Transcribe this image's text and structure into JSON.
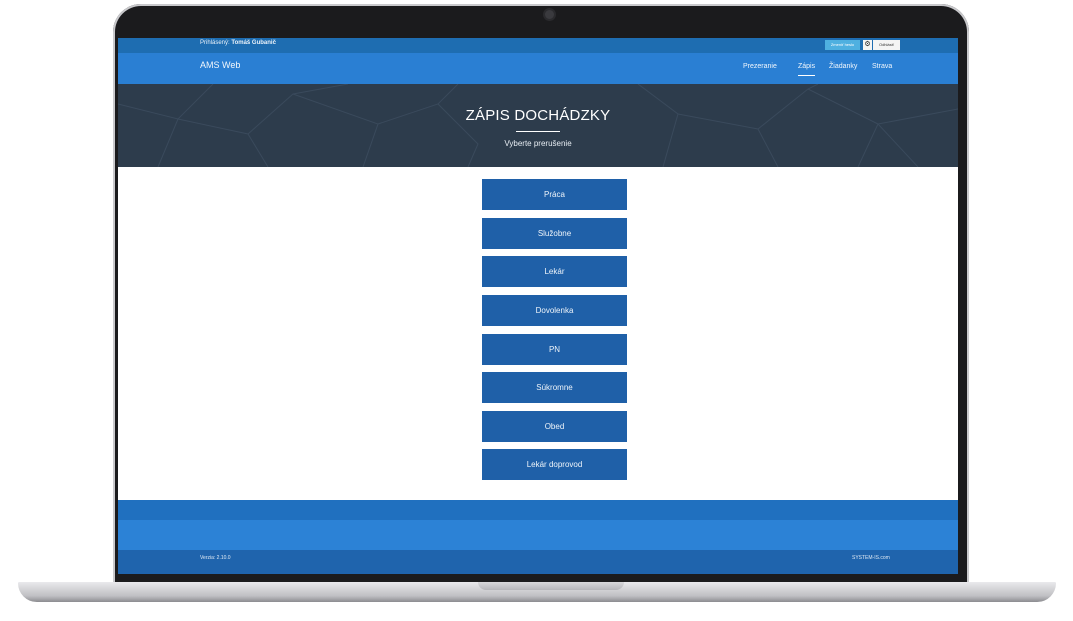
{
  "topbar": {
    "logged_label": "Prihlásený:",
    "logged_user": "Tomáš Gubanič",
    "change_button": "Zmeniť heslo",
    "logout_button": "Odhlásiť"
  },
  "navbar": {
    "brand": "AMS Web",
    "items": [
      {
        "label": "Prezeranie",
        "active": false
      },
      {
        "label": "Zápis",
        "active": true
      },
      {
        "label": "Žiadanky",
        "active": false
      },
      {
        "label": "Strava",
        "active": false
      }
    ]
  },
  "hero": {
    "title": "ZÁPIS DOCHÁDZKY",
    "subtitle": "Vyberte prerušenie"
  },
  "interruptions": [
    "Práca",
    "Služobne",
    "Lekár",
    "Dovolenka",
    "PN",
    "Súkromne",
    "Obed",
    "Lekár doprovod"
  ],
  "footer": {
    "version": "Verzia: 2.10.0",
    "company": "SYSTEM-IS.com"
  },
  "colors": {
    "topbar": "#1e6db1",
    "navbar": "#2a7fd3",
    "hero": "#2d3c4c",
    "button": "#1f60a8",
    "footer": "#1f64ad"
  },
  "icons": {
    "settings": "gear-icon"
  }
}
